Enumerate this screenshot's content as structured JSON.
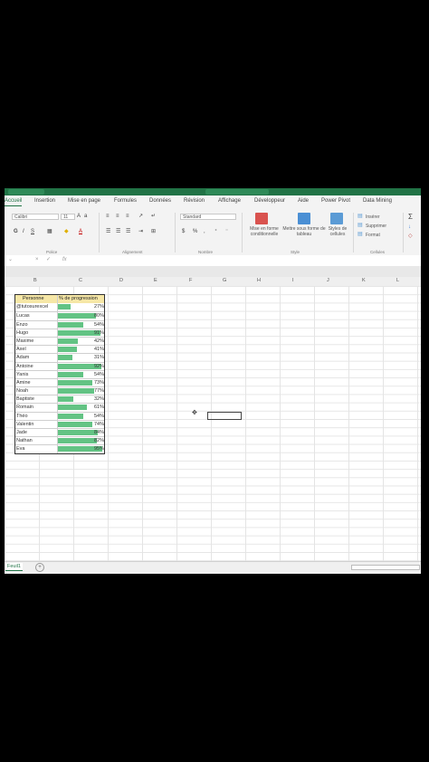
{
  "colors": {
    "excel_green": "#217346",
    "databar": "#63c384",
    "header_fill": "#f6e7a6"
  },
  "menu": {
    "tabs": [
      "Accueil",
      "Insertion",
      "Mise en page",
      "Formules",
      "Données",
      "Révision",
      "Affichage",
      "Développeur",
      "Aide",
      "Power Pivot",
      "Data Mining"
    ],
    "active": "Accueil"
  },
  "ribbon": {
    "font_name": "Calibri",
    "font_size": "11",
    "number_format": "Standard",
    "bold": "G",
    "italic": "I",
    "underline": "S",
    "cond_format": "Mise en forme conditionnelle",
    "table_format": "Mettre sous forme de tableau",
    "cell_styles": "Styles de cellules",
    "insert": "Insérer",
    "delete": "Supprimer",
    "format": "Format",
    "groups": {
      "police": "Police",
      "alignement": "Alignement",
      "nombre": "Nombre",
      "style": "Style",
      "cellules": "Cellules"
    },
    "icons": [
      "bold-icon",
      "italic-icon",
      "underline-icon",
      "border-icon",
      "fill-color-icon",
      "font-color-icon",
      "align-icon",
      "wrap-icon",
      "merge-icon",
      "currency-icon",
      "percent-icon",
      "sum-icon"
    ]
  },
  "formula_bar": {
    "fx": "fx",
    "cancel": "×",
    "confirm": "✓"
  },
  "columns": [
    "B",
    "C",
    "D",
    "E",
    "F",
    "G",
    "H",
    "I",
    "J",
    "K",
    "L"
  ],
  "table": {
    "headers": {
      "name": "Personne",
      "pct": "% de progression"
    },
    "rows": [
      {
        "name": "@tutosurexcel",
        "pct": "27%",
        "value": 27
      },
      {
        "name": "Lucas",
        "pct": "80%",
        "value": 80
      },
      {
        "name": "Enzo",
        "pct": "54%",
        "value": 54
      },
      {
        "name": "Hugo",
        "pct": "91%",
        "value": 91
      },
      {
        "name": "Maxime",
        "pct": "42%",
        "value": 42
      },
      {
        "name": "Axel",
        "pct": "41%",
        "value": 41
      },
      {
        "name": "Adam",
        "pct": "31%",
        "value": 31
      },
      {
        "name": "Antoine",
        "pct": "92%",
        "value": 92
      },
      {
        "name": "Yanis",
        "pct": "54%",
        "value": 54
      },
      {
        "name": "Amine",
        "pct": "73%",
        "value": 73
      },
      {
        "name": "Noah",
        "pct": "77%",
        "value": 77
      },
      {
        "name": "Baptiste",
        "pct": "32%",
        "value": 32
      },
      {
        "name": "Romain",
        "pct": "61%",
        "value": 61
      },
      {
        "name": "Théo",
        "pct": "54%",
        "value": 54
      },
      {
        "name": "Valentin",
        "pct": "74%",
        "value": 74
      },
      {
        "name": "Jade",
        "pct": "84%",
        "value": 84
      },
      {
        "name": "Nathan",
        "pct": "82%",
        "value": 82
      },
      {
        "name": "Eva",
        "pct": "95%",
        "value": 95
      }
    ]
  },
  "sheet": {
    "name": "Feuil1",
    "add": "+"
  }
}
